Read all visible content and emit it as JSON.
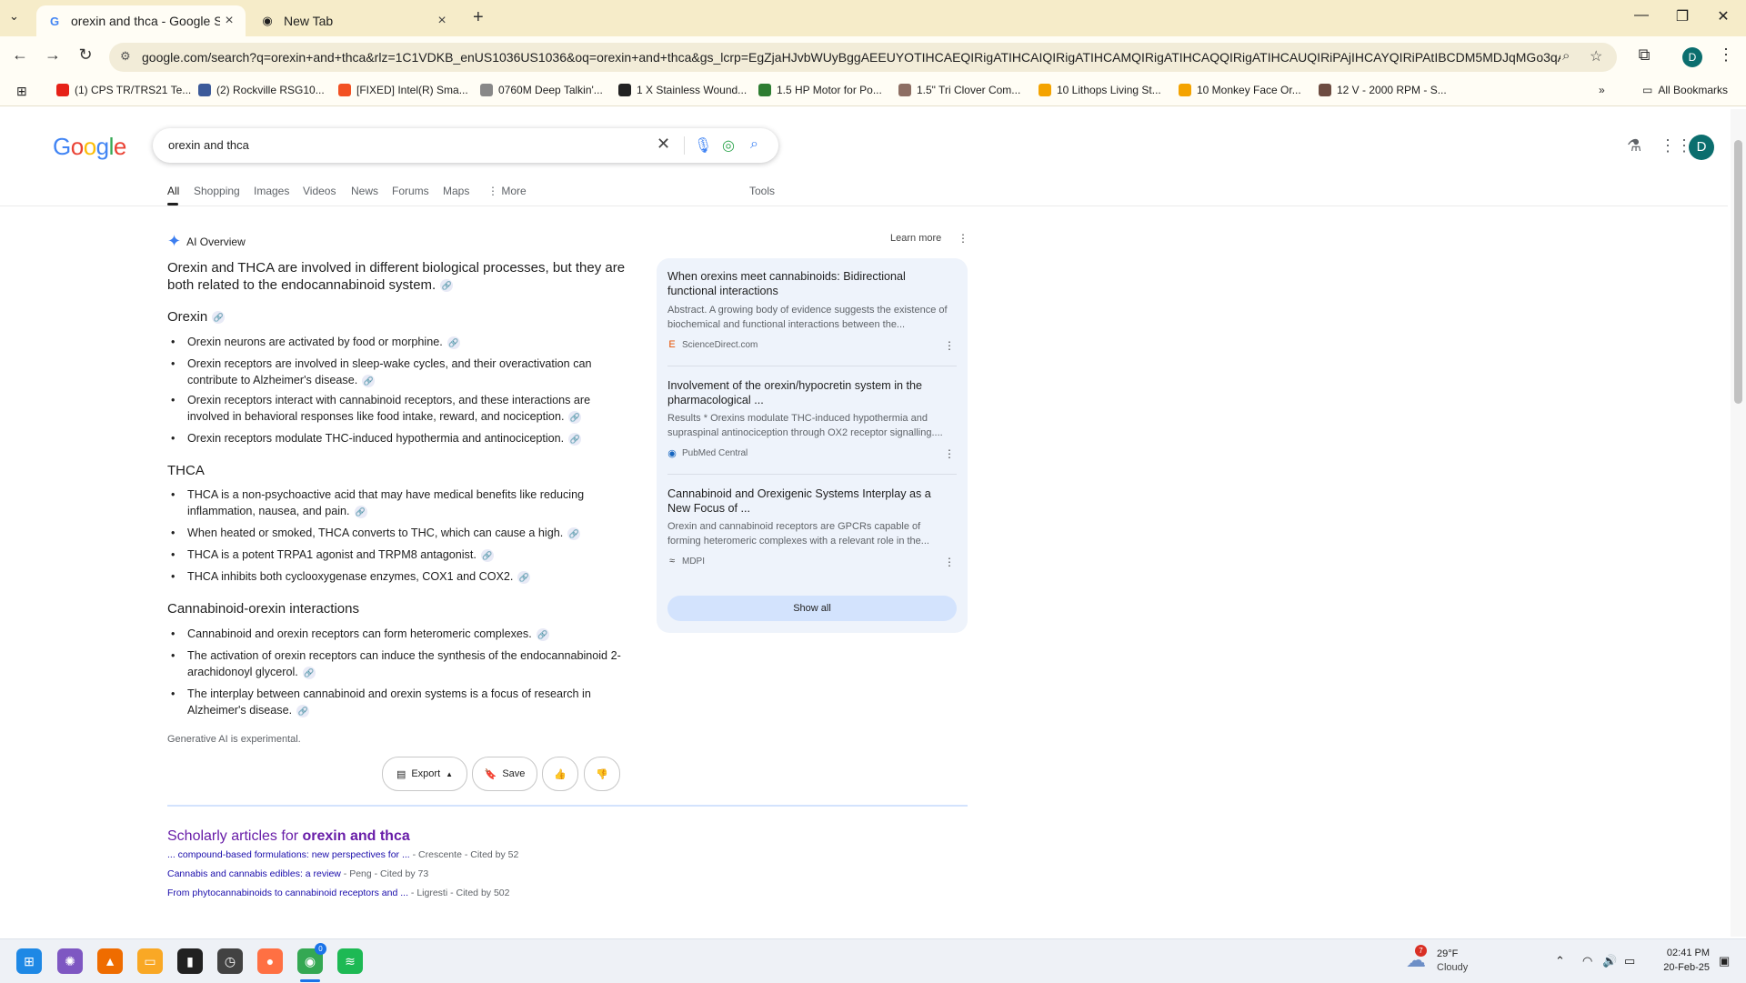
{
  "browser": {
    "tabs": [
      {
        "title": "orexin and thca - Google Search",
        "active": true
      },
      {
        "title": "New Tab",
        "active": false
      }
    ],
    "url": "google.com/search?q=orexin+and+thca&rlz=1C1VDKB_enUS1036US1036&oq=orexin+and+thca&gs_lcrp=EgZjaHJvbWUyBggAEEUYOTIHCAEQIRigATIHCAIQIRigATIHCAMQIRigATIHCAQQIRigATIHCAUQIRiPAjIHCAYQIRiPAtIBCDM5MDJqMGo3qAIAs...",
    "bookmarks": [
      "(1) CPS TR/TRS21 Te...",
      "(2) Rockville RSG10...",
      "[FIXED] Intel(R) Sma...",
      "0760M Deep Talkin'...",
      "1 X Stainless Wound...",
      "1.5 HP Motor for Po...",
      "1.5\" Tri Clover Com...",
      "10 Lithops Living St...",
      "10 Monkey Face Or...",
      "12 V - 2000 RPM - S..."
    ],
    "all_bookmarks": "All Bookmarks",
    "profile_initial": "D"
  },
  "google": {
    "logo": "Google",
    "query": "orexin and thca",
    "filters": [
      "All",
      "Shopping",
      "Images",
      "Videos",
      "News",
      "Forums",
      "Maps",
      "More"
    ],
    "tools": "Tools",
    "avatar": "D"
  },
  "ai": {
    "title": "AI Overview",
    "learn_more": "Learn more",
    "intro": "Orexin and THCA are involved in different biological processes, but they are both related to the endocannabinoid system.",
    "sections": [
      {
        "heading": "Orexin",
        "bullets": [
          "Orexin neurons are activated by food or morphine.",
          "Orexin receptors are involved in sleep-wake cycles, and their overactivation can contribute to Alzheimer's disease.",
          "Orexin receptors interact with cannabinoid receptors, and these interactions are involved in behavioral responses like food intake, reward, and nociception.",
          "Orexin receptors modulate THC-induced hypothermia and antinociception."
        ]
      },
      {
        "heading": "THCA",
        "bullets": [
          "THCA is a non-psychoactive acid that may have medical benefits like reducing inflammation, nausea, and pain.",
          "When heated or smoked, THCA converts to THC, which can cause a high.",
          "THCA is a potent TRPA1 agonist and TRPM8 antagonist.",
          "THCA inhibits both cyclooxygenase enzymes, COX1 and COX2."
        ]
      },
      {
        "heading": "Cannabinoid-orexin interactions",
        "bullets": [
          "Cannabinoid and orexin receptors can form heteromeric complexes.",
          "The activation of orexin receptors can induce the synthesis of the endocannabinoid 2-arachidonoyl glycerol.",
          "The interplay between cannabinoid and orexin systems is a focus of research in Alzheimer's disease."
        ]
      }
    ],
    "note": "Generative AI is experimental.",
    "export": "Export",
    "save": "Save"
  },
  "sources": [
    {
      "title": "When orexins meet cannabinoids: Bidirectional functional interactions",
      "desc": "Abstract. A growing body of evidence suggests the existence of biochemical and functional interactions between the...",
      "site": "ScienceDirect.com"
    },
    {
      "title": "Involvement of the orexin/hypocretin system in the pharmacological ...",
      "desc": "Results * Orexins modulate THC-induced hypothermia and supraspinal antinociception through OX2 receptor signalling....",
      "site": "PubMed Central"
    },
    {
      "title": "Cannabinoid and Orexigenic Systems Interplay as a New Focus of ...",
      "desc": "Orexin and cannabinoid receptors are GPCRs capable of forming heteromeric complexes with a relevant role in the...",
      "site": "MDPI"
    }
  ],
  "show_all": "Show all",
  "scholarly": {
    "prefix": "Scholarly articles for ",
    "query": "orexin and thca",
    "items": [
      {
        "title": "... compound-based formulations: new perspectives for ...",
        "meta": " - Crescente - Cited by 52"
      },
      {
        "title": "Cannabis and cannabis edibles: a review",
        "meta": " - Peng - Cited by 73"
      },
      {
        "title": "From phytocannabinoids to cannabinoid receptors and ...",
        "meta": " - Ligresti - Cited by 502"
      }
    ]
  },
  "taskbar": {
    "weather_badge": "7",
    "temp": "29°F",
    "condition": "Cloudy",
    "time": "02:41 PM",
    "date": "20-Feb-25",
    "chrome_badge": "0"
  }
}
